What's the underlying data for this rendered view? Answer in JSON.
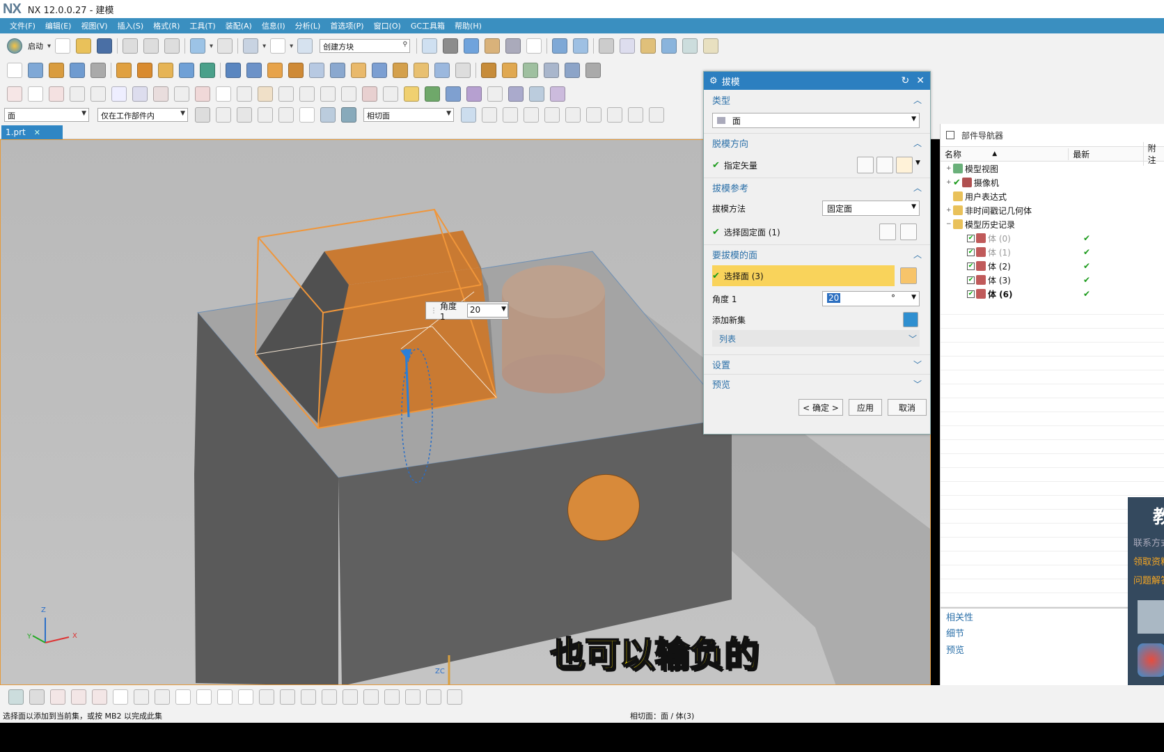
{
  "app": {
    "logo": "NX",
    "title": "NX 12.0.0.27 - 建模"
  },
  "menu": [
    "文件(F)",
    "编辑(E)",
    "视图(V)",
    "插入(S)",
    "格式(R)",
    "工具(T)",
    "装配(A)",
    "信息(I)",
    "分析(L)",
    "首选项(P)",
    "窗口(O)",
    "GC工具箱",
    "帮助(H)"
  ],
  "toolbar1": {
    "start_label": "启动",
    "search_placeholder": "创建方块"
  },
  "toolbar4": {
    "select_filter": "面",
    "scope": "仅在工作部件内",
    "face_rule": "相切面"
  },
  "doc_tab": {
    "label": "1.prt"
  },
  "viewport": {
    "angle_tip_label": "角度 1",
    "angle_tip_value": "20",
    "subtitle": "也可以输负的",
    "triad_x": "X",
    "triad_y": "Y",
    "triad_z": "Z",
    "origin_label": "ZC"
  },
  "draft_dialog": {
    "title": "拔模",
    "type_section": "类型",
    "type_value": "面",
    "direction_section": "脱模方向",
    "specify_vector": "指定矢量",
    "reference_section": "拔模参考",
    "draft_method_label": "拔模方法",
    "draft_method_value": "固定面",
    "select_fixed_face": "选择固定面 (1)",
    "faces_section": "要拔模的面",
    "select_faces": "选择面 (3)",
    "angle_label": "角度 1",
    "angle_value": "20",
    "angle_unit": "°",
    "add_new_set": "添加新集",
    "list_label": "列表",
    "settings_section": "设置",
    "preview_section": "预览",
    "ok_button": "< 确定 >",
    "apply_button": "应用",
    "cancel_button": "取消"
  },
  "part_navigator": {
    "title": "部件导航器",
    "col_name": "名称",
    "col_latest": "最新",
    "col_attached": "附注",
    "items": [
      {
        "label": "模型视图"
      },
      {
        "label": "摄像机"
      },
      {
        "label": "用户表达式"
      },
      {
        "label": "非时间戳记几何体"
      },
      {
        "label": "模型历史记录"
      }
    ],
    "history": [
      {
        "label": "体 (0)"
      },
      {
        "label": "体 (1)"
      },
      {
        "label": "体 (2)"
      },
      {
        "label": "体 (3)"
      },
      {
        "label": "体 (6)"
      }
    ],
    "latest_mark": "✔",
    "bottom_sections": [
      "相关性",
      "细节",
      "预览"
    ]
  },
  "side_ad": {
    "big": "教",
    "line1": "联系方式",
    "line2": "领取资料",
    "line3": "问题解答"
  },
  "status": {
    "prompt": "选择面以添加到当前集，或按 MB2 以完成此集",
    "selection": "相切面：面 / 体(3)"
  },
  "colors": {
    "accent": "#2c7fc0",
    "menu_bar": "#3a8fc0",
    "highlight": "#f9d35b",
    "draft_body": "#c97a32"
  }
}
